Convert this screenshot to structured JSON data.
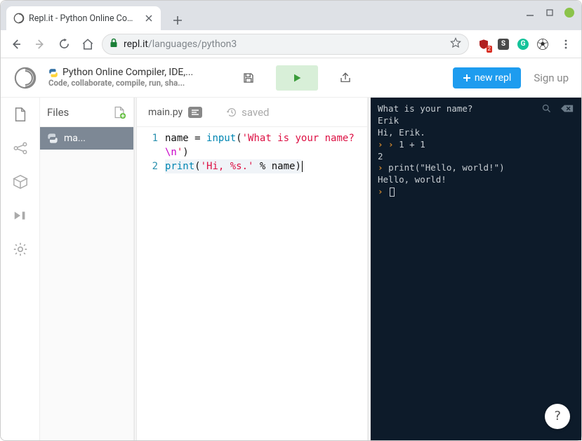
{
  "browser": {
    "tab_title": "Repl.it - Python Online Compil",
    "url_host": "repl.it",
    "url_path": "/languages/python3",
    "ext_badge": "2"
  },
  "header": {
    "title": "Python Online Compiler, IDE,...",
    "subtitle": "Code, collaborate, compile, run, sha...",
    "new_repl_label": "new repl",
    "signup_label": "Sign up"
  },
  "files": {
    "header_label": "Files",
    "items": [
      {
        "name": "ma..."
      }
    ]
  },
  "editor": {
    "tab_label": "main.py",
    "saved_label": "saved",
    "gutter": [
      "1",
      "2"
    ],
    "line1_parts": {
      "name": "name",
      "assign": " = ",
      "func": "input",
      "str_a": "'What is your name?",
      "esc": "\\n",
      "str_b": "'"
    },
    "line2_parts": {
      "func": "print",
      "str": "'Hi, %s.'",
      "op": " % ",
      "arg": "name"
    }
  },
  "console": {
    "l1": "What is your name?",
    "l2": "Erik",
    "l3": "Hi, Erik.",
    "l4_expr": "1 + 1",
    "l5": "2",
    "l6_expr": "print(\"Hello, world!\")",
    "l7": "Hello, world!",
    "help_label": "?"
  }
}
